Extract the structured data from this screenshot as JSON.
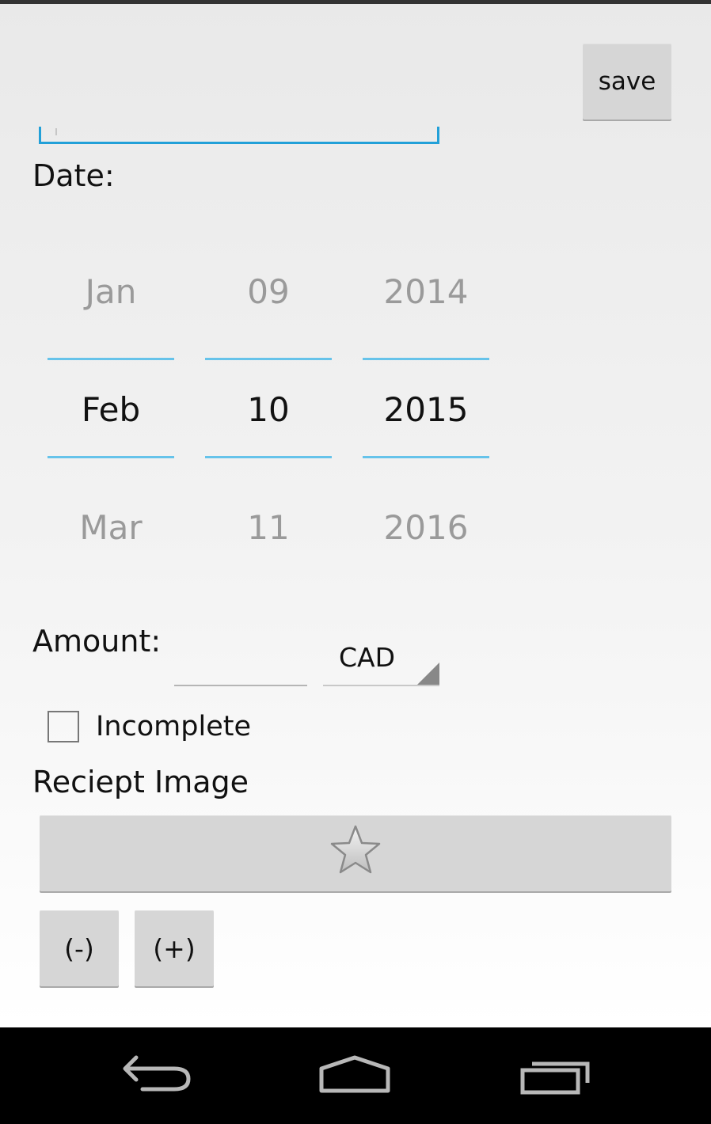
{
  "header": {
    "save_label": "save"
  },
  "title_field": {
    "value": ""
  },
  "date": {
    "label": "Date:",
    "month": {
      "prev": "Jan",
      "current": "Feb",
      "next": "Mar"
    },
    "day": {
      "prev": "09",
      "current": "10",
      "next": "11"
    },
    "year": {
      "prev": "2014",
      "current": "2015",
      "next": "2016"
    }
  },
  "amount": {
    "label": "Amount:",
    "value": "",
    "currency": "CAD"
  },
  "incomplete": {
    "label": "Incomplete",
    "checked": false
  },
  "receipt": {
    "label": "Reciept Image",
    "image_icon": "star-icon",
    "minus_label": "(-)",
    "plus_label": "(+)"
  },
  "navbar": {
    "icons": [
      "back-icon",
      "home-icon",
      "recent-apps-icon"
    ]
  },
  "colors": {
    "accent": "#22a0d8",
    "picker_divider": "#66c3ea",
    "button_bg": "#d6d6d6"
  }
}
